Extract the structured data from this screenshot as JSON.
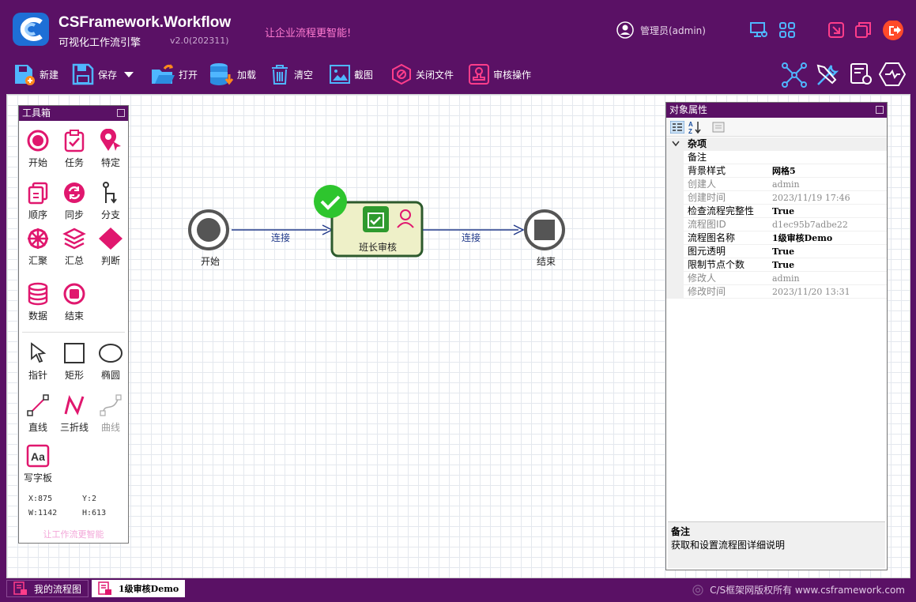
{
  "app": {
    "name": "CSFramework.Workflow",
    "subtitle": "可视化工作流引擎",
    "version": "v2.0(202311)",
    "slogan": "让企业流程更智能!",
    "user": "管理员(admin)"
  },
  "toolbar": {
    "new": "新建",
    "save": "保存",
    "open": "打开",
    "load": "加载",
    "clear": "清空",
    "screenshot": "截图",
    "close_file": "关闭文件",
    "review": "审核操作"
  },
  "toolbox": {
    "title": "工具箱",
    "tools": {
      "start": "开始",
      "task": "任务",
      "special": "特定",
      "sequence": "顺序",
      "sync": "同步",
      "branch": "分支",
      "merge": "汇聚",
      "summary": "汇总",
      "decision": "判断",
      "data": "数据",
      "end": "结束",
      "pointer": "指针",
      "rect": "矩形",
      "ellipse": "椭圆",
      "line": "直线",
      "polyline": "三折线",
      "curve": "曲线",
      "textbox": "写字板"
    },
    "coords": {
      "x": "X:875",
      "y": "Y:2",
      "w": "W:1142",
      "h": "H:613"
    },
    "footer": "让工作流更智能"
  },
  "flow": {
    "start_label": "开始",
    "task_label": "班长审核",
    "end_label": "结束",
    "edge1_label": "连接",
    "edge2_label": "连接"
  },
  "props": {
    "title": "对象属性",
    "category": "杂项",
    "rows": [
      {
        "key": "备注",
        "value": "",
        "dim": false,
        "bold": false
      },
      {
        "key": "背景样式",
        "value": "网格5",
        "dim": false,
        "bold": true
      },
      {
        "key": "创建人",
        "value": "admin",
        "dim": true,
        "bold": false
      },
      {
        "key": "创建时间",
        "value": "2023/11/19 17:46",
        "dim": true,
        "bold": false
      },
      {
        "key": "检查流程完整性",
        "value": "True",
        "dim": false,
        "bold": true
      },
      {
        "key": "流程图ID",
        "value": "d1ec95b7adbe22",
        "dim": true,
        "bold": false
      },
      {
        "key": "流程图名称",
        "value": "1级审核Demo",
        "dim": false,
        "bold": true
      },
      {
        "key": "图元透明",
        "value": "True",
        "dim": false,
        "bold": true
      },
      {
        "key": "限制节点个数",
        "value": "True",
        "dim": false,
        "bold": true
      },
      {
        "key": "修改人",
        "value": "admin",
        "dim": true,
        "bold": false
      },
      {
        "key": "修改时间",
        "value": "2023/11/20 13:31",
        "dim": true,
        "bold": false
      }
    ],
    "desc_title": "备注",
    "desc_text": "获取和设置流程图详细说明"
  },
  "status": {
    "tab1": "我的流程图",
    "tab2": "1级审核Demo",
    "copyright": "C/S框架网版权所有 www.csframework.com"
  },
  "colors": {
    "brand": "#5a1165",
    "accent": "#e0176e",
    "task_border": "#2d5a2d",
    "task_fill": "#eef0c8"
  }
}
